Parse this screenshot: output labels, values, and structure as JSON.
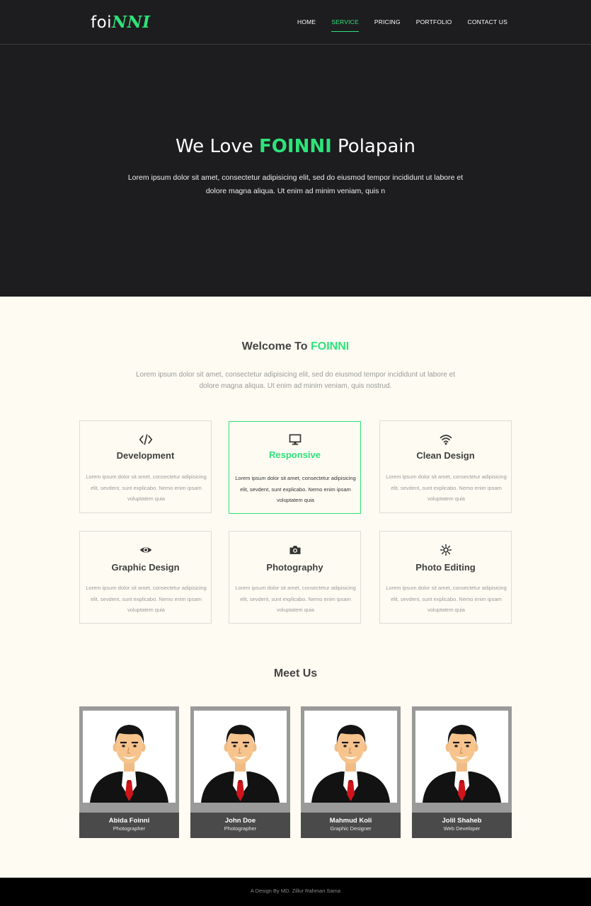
{
  "brand": {
    "logo_plain": "foi",
    "logo_accent": "NNI"
  },
  "nav": {
    "items": [
      {
        "label": "HOME",
        "active": false
      },
      {
        "label": "SERVICE",
        "active": true
      },
      {
        "label": "PRICING",
        "active": false
      },
      {
        "label": "PORTFOLIO",
        "active": false
      },
      {
        "label": "CONTACT US",
        "active": false
      }
    ]
  },
  "hero": {
    "title_before": "We Love",
    "title_brand": "FOINNI",
    "title_after": "Polapain",
    "text": "Lorem ipsum dolor sit amet, consectetur adipisicing elit, sed do eiusmod tempor incididunt ut labore et dolore magna aliqua. Ut enim ad minim veniam, quis n"
  },
  "welcome": {
    "title_before": "Welcome To",
    "title_brand": "FOINNI",
    "text": "Lorem ipsum dolor sit amet, consectetur adipisicing elit, sed do eiusmod tempor incididunt ut labore et dolore magna aliqua. Ut enim ad minim veniam, quis nostrud."
  },
  "services": [
    {
      "icon": "code-icon",
      "title": "Development",
      "text": "Lorem ipsum dolor sit amet, consectetur adipisicing elit, sevdent, sunt explicabo. Nemo enim ipsam voluptatem quia",
      "featured": false
    },
    {
      "icon": "monitor-icon",
      "title": "Responsive",
      "text": "Lorem ipsum dolor sit amet, consectetur adipisicing elit, sevdent, sunt explicabo. Nemo enim ipsam voluptatem quia",
      "featured": true
    },
    {
      "icon": "wifi-icon",
      "title": "Clean Design",
      "text": "Lorem ipsum dolor sit amet, consectetur adipisicing elit, sevdent, sunt explicabo. Nemo enim ipsam voluptatem quia",
      "featured": false
    },
    {
      "icon": "eye-icon",
      "title": "Graphic Design",
      "text": "Lorem ipsum dolor sit amet, consectetur adipisicing elit, sevdent, sunt explicabo. Nemo enim ipsam voluptatem quia",
      "featured": false
    },
    {
      "icon": "camera-icon",
      "title": "Photography",
      "text": "Lorem ipsum dolor sit amet, consectetur adipisicing elit, sevdent, sunt explicabo. Nemo enim ipsam voluptatem quia",
      "featured": false
    },
    {
      "icon": "brightness-icon",
      "title": "Photo Editing",
      "text": "Lorem ipsum dolor sit amet, consectetur adipisicing elit, sevdent, sunt explicabo. Nemo enim ipsam voluptatem quia",
      "featured": false
    }
  ],
  "team": {
    "title": "Meet Us",
    "members": [
      {
        "name": "Abida Foinni",
        "role": "Photographer"
      },
      {
        "name": "John Doe",
        "role": "Photographer"
      },
      {
        "name": "Mahmud Koli",
        "role": "Graphic Designer"
      },
      {
        "name": "Jolil Shaheb",
        "role": "Web Developer"
      }
    ]
  },
  "footer": {
    "text": "A Design By MD. Zillur Rahman Sama"
  },
  "colors": {
    "accent": "#2ee37a",
    "header_bg": "#1d1d1f",
    "page_bg": "#fdfbf2",
    "footer_bg": "#000000"
  }
}
